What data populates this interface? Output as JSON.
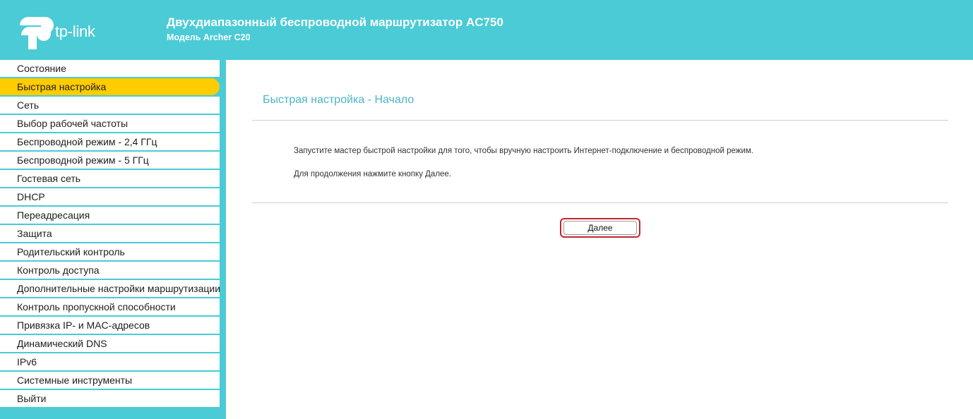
{
  "header": {
    "logo_text": "tp-link",
    "title": "Двухдиапазонный беспроводной маршрутизатор AC750",
    "subtitle": "Модель Archer C20"
  },
  "sidebar": {
    "items": [
      {
        "label": "Состояние"
      },
      {
        "label": "Быстрая настройка",
        "active": true
      },
      {
        "label": "Сеть"
      },
      {
        "label": "Выбор рабочей частоты"
      },
      {
        "label": "Беспроводной режим - 2,4 ГГц"
      },
      {
        "label": "Беспроводной режим - 5 ГГц"
      },
      {
        "label": "Гостевая сеть"
      },
      {
        "label": "DHCP"
      },
      {
        "label": "Переадресация"
      },
      {
        "label": "Защита"
      },
      {
        "label": "Родительский контроль"
      },
      {
        "label": "Контроль доступа"
      },
      {
        "label": "Дополнительные настройки маршрутизации"
      },
      {
        "label": "Контроль пропускной способности"
      },
      {
        "label": "Привязка IP- и MAC-адресов"
      },
      {
        "label": "Динамический DNS"
      },
      {
        "label": "IPv6"
      },
      {
        "label": "Системные инструменты"
      },
      {
        "label": "Выйти"
      }
    ]
  },
  "main": {
    "section_title": "Быстрая настройка - Начало",
    "paragraph1": "Запустите мастер быстрой настройки для того, чтобы вручную настроить Интернет-подключение и беспроводной режим.",
    "paragraph2": "Для продолжения нажмите кнопку Далее.",
    "next_button": "Далее"
  },
  "colors": {
    "brand": "#4acbd6",
    "active_item": "#ffcc00",
    "section_title": "#4ab6c9",
    "button_highlight": "#c0272d"
  }
}
